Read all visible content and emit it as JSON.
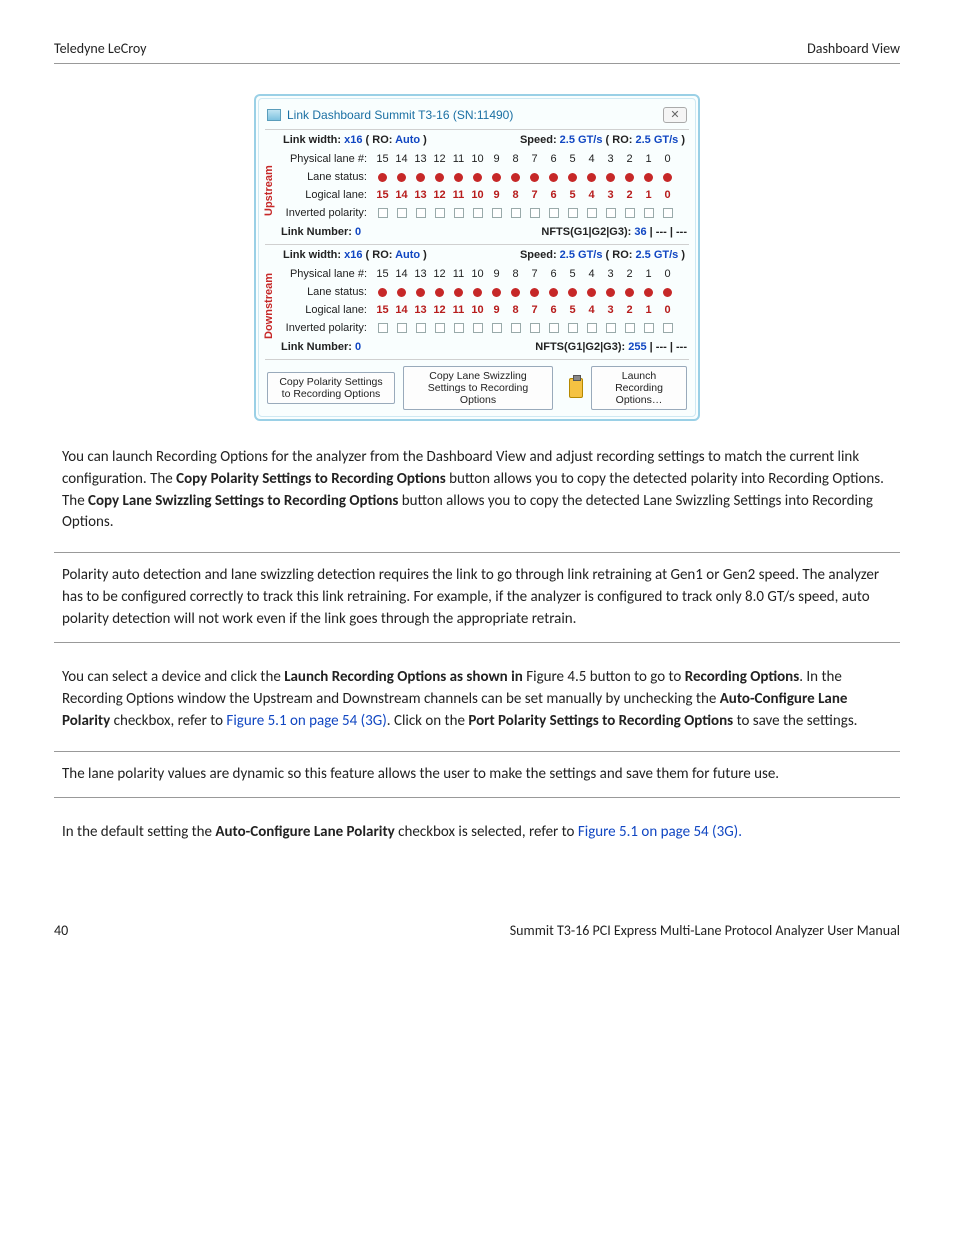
{
  "header": {
    "left": "Teledyne LeCroy",
    "right": "Dashboard View"
  },
  "dialog": {
    "title": "Link Dashboard Summit T3-16 (SN:11490)",
    "close_glyph": "✕",
    "lanes": [
      "15",
      "14",
      "13",
      "12",
      "11",
      "10",
      "9",
      "8",
      "7",
      "6",
      "5",
      "4",
      "3",
      "2",
      "1",
      "0"
    ],
    "labels": {
      "linkwidth_prefix": "Link width: ",
      "linkwidth_value": "x16",
      "linkwidth_ro_prefix": " ( RO: ",
      "linkwidth_ro_value": "Auto",
      "linkwidth_suffix": " )",
      "speed_prefix": "Speed: ",
      "speed_value": "2.5 GT/s",
      "speed_ro_prefix": " ( RO: ",
      "speed_ro_value": "2.5 GT/s",
      "speed_suffix": " )",
      "physical": "Physical lane #:",
      "status": "Lane status:",
      "logical": "Logical lane:",
      "inverted": "Inverted polarity:",
      "linknum_prefix": "Link Number: ",
      "linknum_value": "0",
      "nfts_prefix": "NFTS(G1|G2|G3): ",
      "nfts_sep": " | ",
      "nfts_dash": "---"
    },
    "upstream": {
      "vlabel": "Upstream",
      "nfts_g1": "36"
    },
    "downstream": {
      "vlabel": "Downstream",
      "nfts_g1": "255"
    },
    "buttons": {
      "copy_polarity": "Copy Polarity Settings to Recording Options",
      "copy_swizzling": "Copy Lane Swizzling Settings to Recording Options",
      "launch": "Launch Recording Options…"
    }
  },
  "paras": {
    "p1a": "You can launch Recording Options for the analyzer from the Dashboard View and adjust recording settings to match the current link configuration. The ",
    "p1b": "Copy Polarity Settings to Recording Options",
    "p1c": " button allows you to copy the detected polarity into Recording Options. The ",
    "p1d": "Copy Lane Swizzling Settings to Recording Options",
    "p1e": " button allows you to copy the detected Lane Swizzling Settings into Recording Options.",
    "n1": "Polarity auto detection and lane swizzling detection requires the link to go through link retraining at Gen1 or Gen2 speed. The analyzer has to be configured correctly to track this link retraining. For example, if the analyzer is configured to track only 8.0 GT/s speed, auto polarity detection will not work even if the link goes through the appropriate retrain.",
    "p2a": "You can select a device and click the ",
    "p2b": "Launch Recording Options as shown in",
    "p2c": " Figure 4.5 button to go to ",
    "p2d": "Recording Options",
    "p2e": ". In the Recording Options window the Upstream and Downstream channels can be set manually by unchecking the ",
    "p2f": "Auto-Configure Lane Polarity",
    "p2g": " checkbox, refer to ",
    "p2h": "Figure 5.1 on page 54 (3G)",
    "p2i": ". Click on the ",
    "p2j": "Port Polarity Settings to Recording Options",
    "p2k": " to save the settings.",
    "n2": "The lane polarity values are dynamic so this feature allows the user to make the settings and save them for future use.",
    "p3a": "In the default setting the ",
    "p3b": "Auto-Configure Lane Polarity",
    "p3c": " checkbox is selected, refer to ",
    "p3d": "Figure 5.1 on page 54 (3G)."
  },
  "footer": {
    "left": "40",
    "right": "Summit T3-16 PCI Express Multi-Lane Protocol Analyzer User Manual"
  }
}
